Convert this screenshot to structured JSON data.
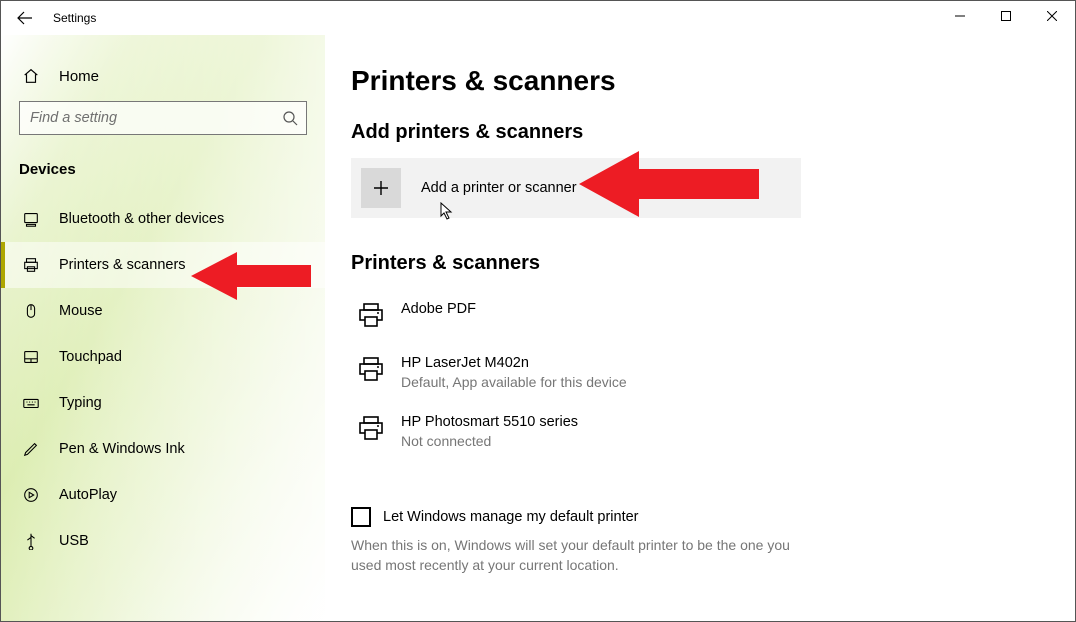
{
  "window": {
    "title": "Settings"
  },
  "sidebar": {
    "home_label": "Home",
    "search_placeholder": "Find a setting",
    "section_label": "Devices",
    "items": [
      {
        "id": "bluetooth",
        "label": "Bluetooth & other devices"
      },
      {
        "id": "printers",
        "label": "Printers & scanners",
        "selected": true
      },
      {
        "id": "mouse",
        "label": "Mouse"
      },
      {
        "id": "touchpad",
        "label": "Touchpad"
      },
      {
        "id": "typing",
        "label": "Typing"
      },
      {
        "id": "pen",
        "label": "Pen & Windows Ink"
      },
      {
        "id": "autoplay",
        "label": "AutoPlay"
      },
      {
        "id": "usb",
        "label": "USB"
      }
    ]
  },
  "page": {
    "title": "Printers & scanners",
    "add_section_title": "Add printers & scanners",
    "add_button_label": "Add a printer or scanner",
    "list_section_title": "Printers & scanners",
    "devices": [
      {
        "name": "Adobe PDF",
        "status": ""
      },
      {
        "name": "HP LaserJet M402n",
        "status": "Default, App available for this device"
      },
      {
        "name": "HP Photosmart 5510 series",
        "status": "Not connected"
      }
    ],
    "default_checkbox_label": "Let Windows manage my default printer",
    "default_hint": "When this is on, Windows will set your default printer to be the one you used most recently at your current location."
  }
}
